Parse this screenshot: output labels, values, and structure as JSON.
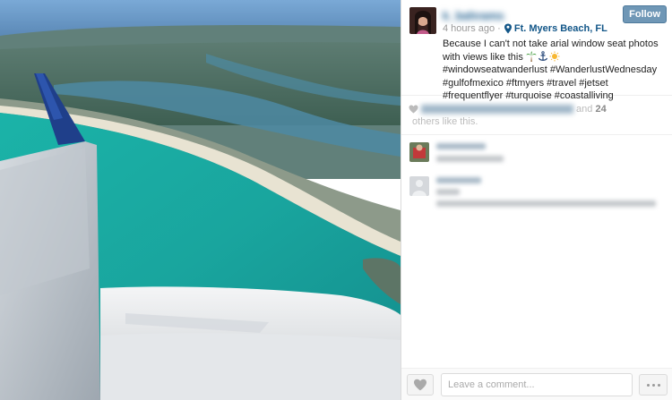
{
  "post": {
    "username": "k_bahrams",
    "follow_label": "Follow",
    "time_ago": "4 hours ago",
    "separator": " · ",
    "location": "Ft. Myers Beach, FL",
    "caption_part1": "Because I can't not take arial window seat photos with views like this ",
    "caption_part2": " #windowseatwanderlust #WanderlustWednesday #gulfofmexico #ftmyers #travel #jetset #frequentflyer #turquoise #coastalliving",
    "emoji_icons": [
      "palm-tree-icon",
      "anchor-icon",
      "sun-icon"
    ]
  },
  "likes": {
    "and_text": " and ",
    "count": "24",
    "others_text": " others like this."
  },
  "comment_box": {
    "placeholder": "Leave a comment..."
  },
  "colors": {
    "link": "#125688",
    "follow_bg": "#6f97b6",
    "muted": "#999999"
  }
}
